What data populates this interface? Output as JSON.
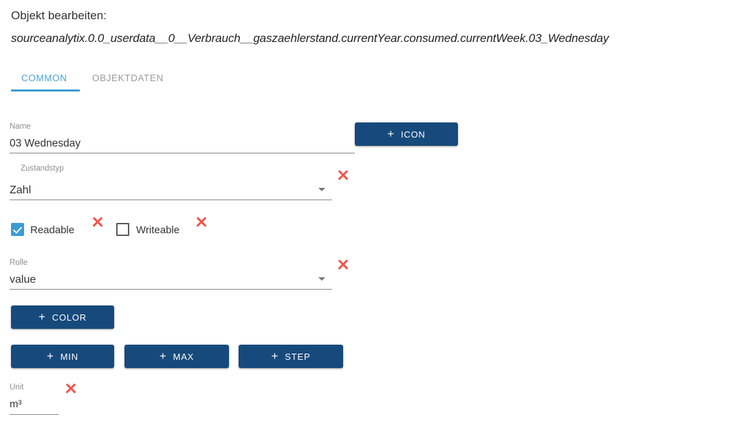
{
  "header": {
    "title": "Objekt bearbeiten:",
    "object_path": "sourceanalytix.0.0_userdata__0__Verbrauch__gaszaehlerstand.currentYear.consumed.currentWeek.03_Wednesday"
  },
  "tabs": [
    {
      "label": "COMMON",
      "active": true
    },
    {
      "label": "OBJEKTDATEN",
      "active": false
    }
  ],
  "form": {
    "name": {
      "label": "Name",
      "value": "03 Wednesday"
    },
    "state_type": {
      "label": "Zustandstyp",
      "value": "Zahl",
      "clear_icon": "close-x-icon"
    },
    "readable": {
      "label": "Readable",
      "checked": true,
      "clear_icon": "close-x-icon"
    },
    "writeable": {
      "label": "Writeable",
      "checked": false,
      "clear_icon": "close-x-icon"
    },
    "role": {
      "label": "Rolle",
      "value": "value",
      "clear_icon": "close-x-icon"
    },
    "unit": {
      "label": "Unit",
      "value": "m³",
      "clear_icon": "close-x-icon"
    }
  },
  "buttons": {
    "icon": {
      "label": "ICON",
      "plus": "+"
    },
    "color": {
      "label": "COLOR",
      "plus": "+"
    },
    "min": {
      "label": "MIN",
      "plus": "+"
    },
    "max": {
      "label": "MAX",
      "plus": "+"
    },
    "step": {
      "label": "STEP",
      "plus": "+"
    }
  },
  "colors": {
    "button_bg": "#174a7c",
    "tab_active": "#4aa3d8",
    "tab_underline": "#3d9bd1",
    "checkbox_checked": "#3b9cd4",
    "delete_x": "#f4544c",
    "label_gray": "#8e8e8e",
    "text": "#333333",
    "background": "#ffffff"
  }
}
